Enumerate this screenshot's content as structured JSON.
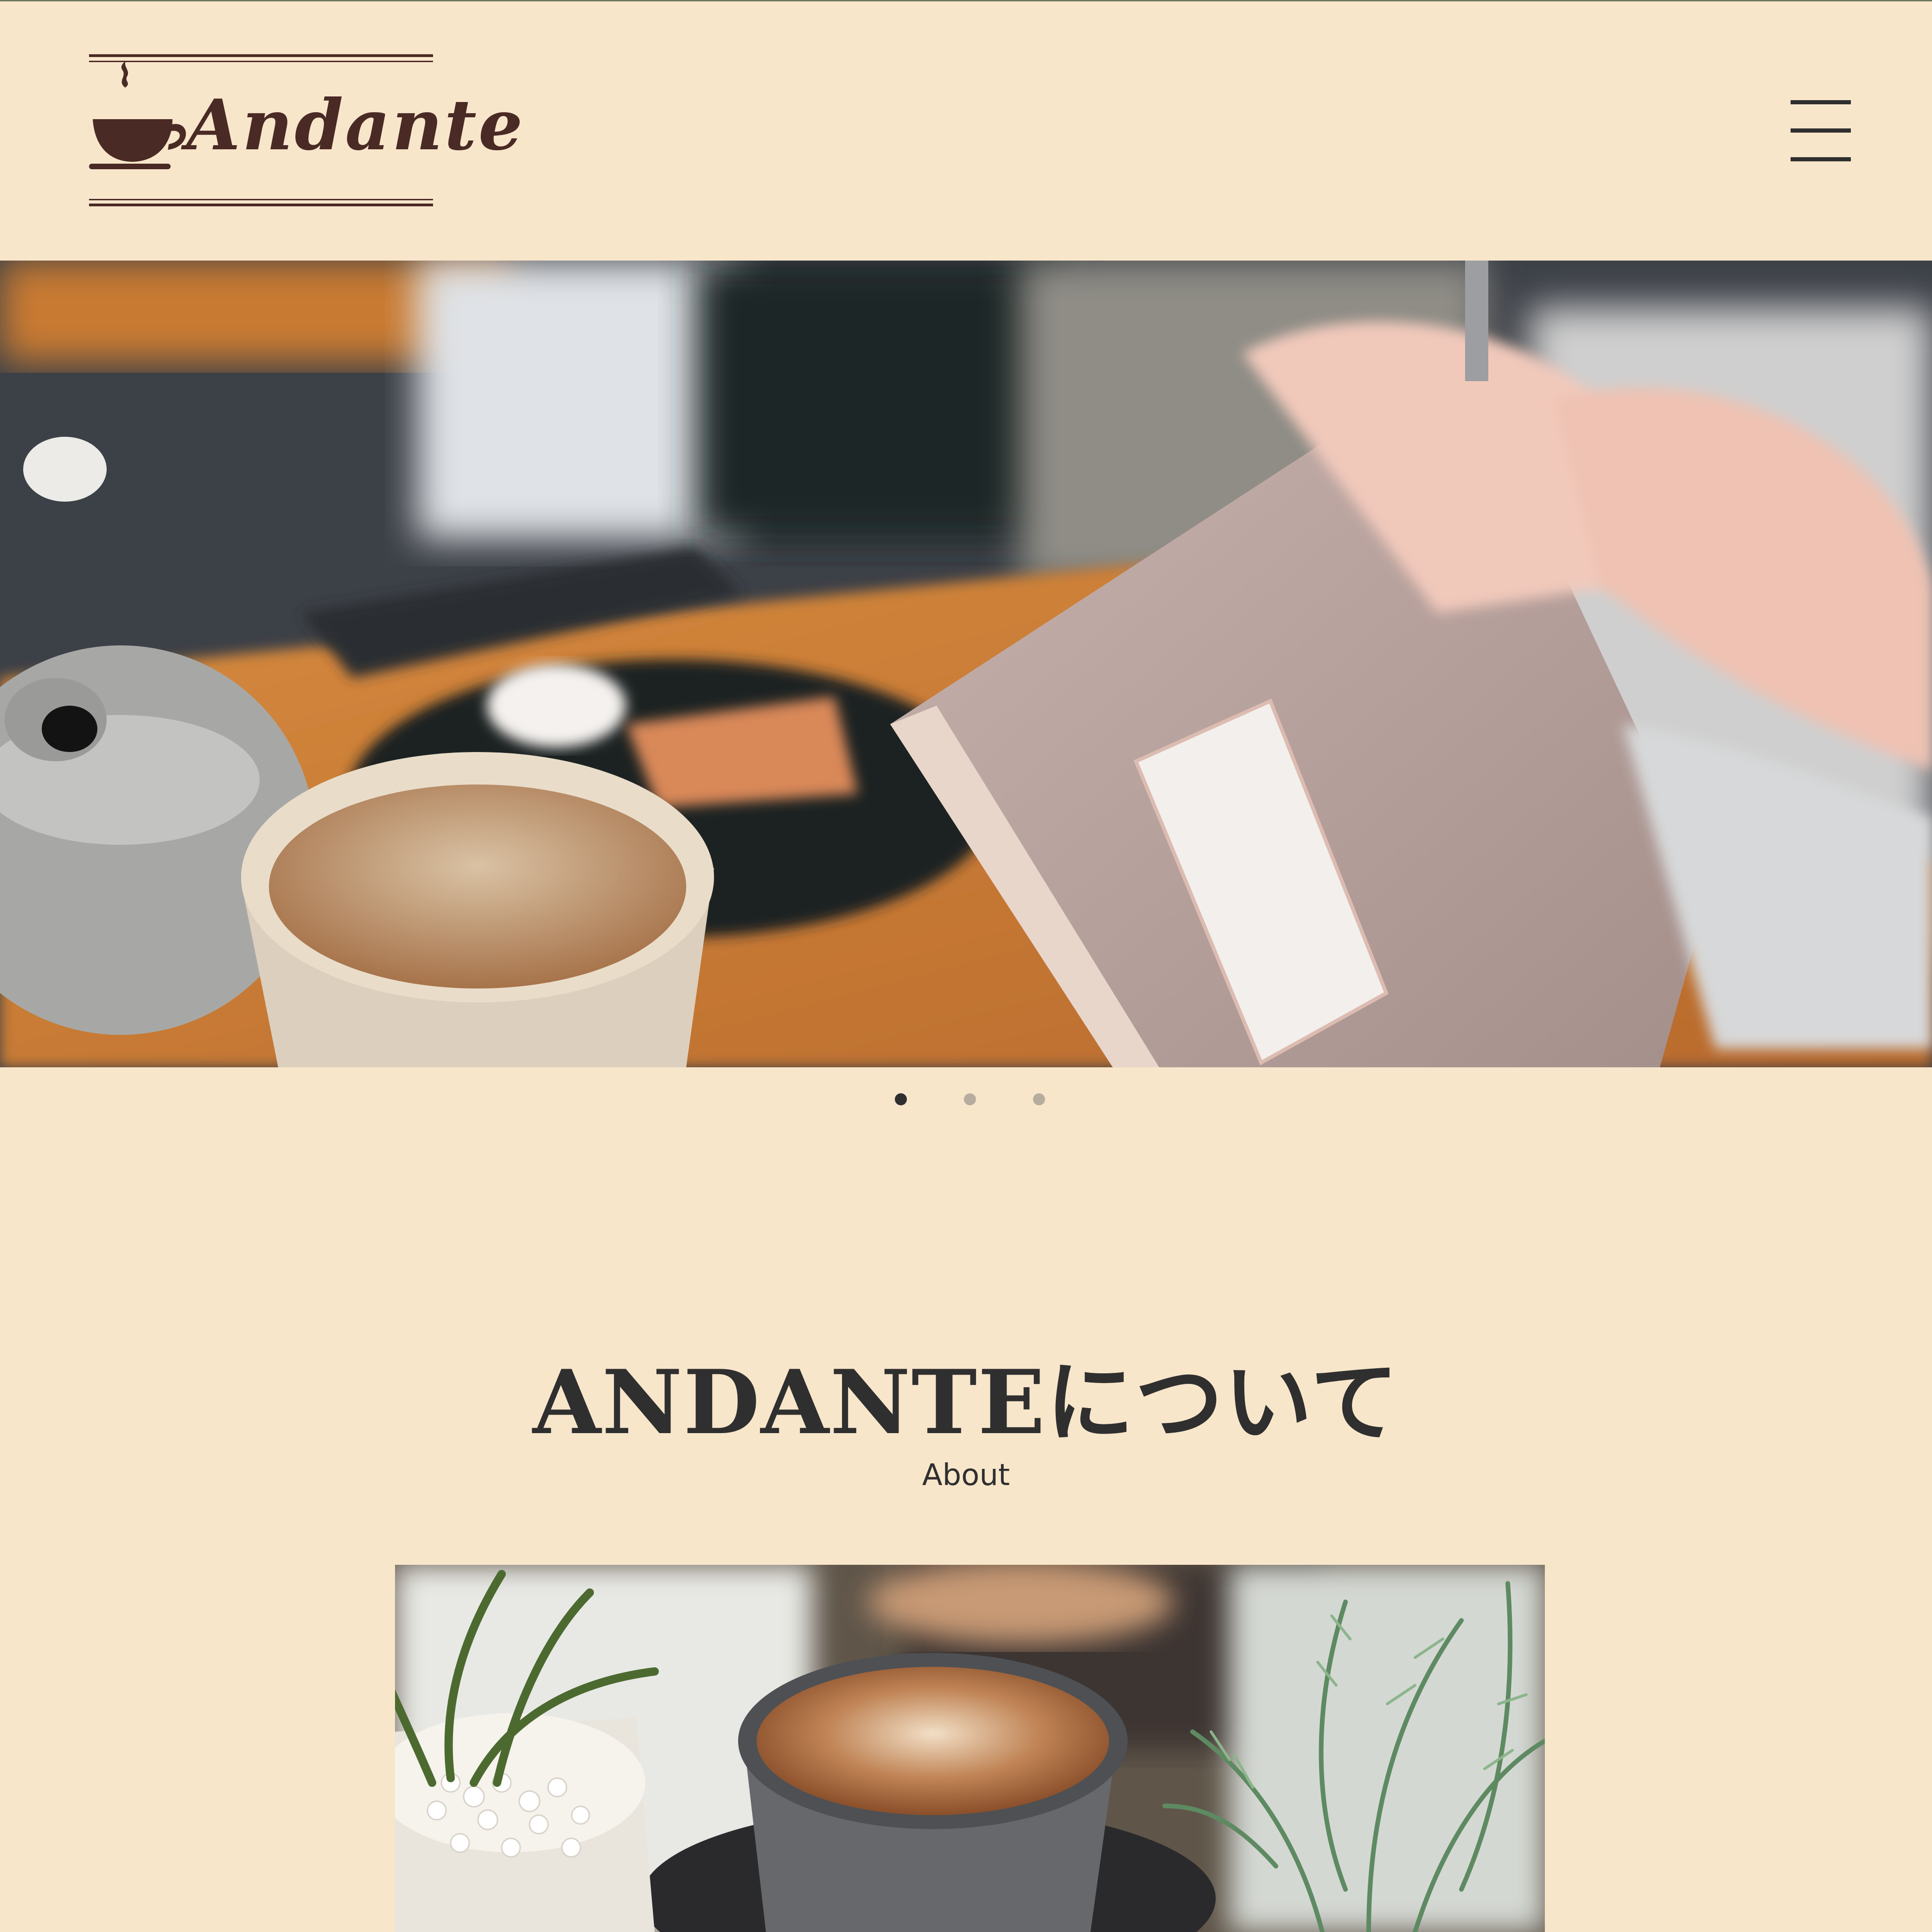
{
  "brand": {
    "name": "Andante"
  },
  "header": {
    "menu_icon": "hamburger-icon"
  },
  "hero": {
    "slide_count": 3,
    "active_slide": 1,
    "image": "cafe table with teapot, ceramic cup and hands holding a notebook"
  },
  "about": {
    "title": "ANDANTEについて",
    "subtitle": "About",
    "image": "latte art coffee cup between potted plants"
  },
  "colors": {
    "background": "#f8e6cb",
    "logo": "#4a2a25",
    "text": "#2f2f2f",
    "dot_active": "#2f2f2f",
    "dot_inactive": "#b7ad9f"
  }
}
